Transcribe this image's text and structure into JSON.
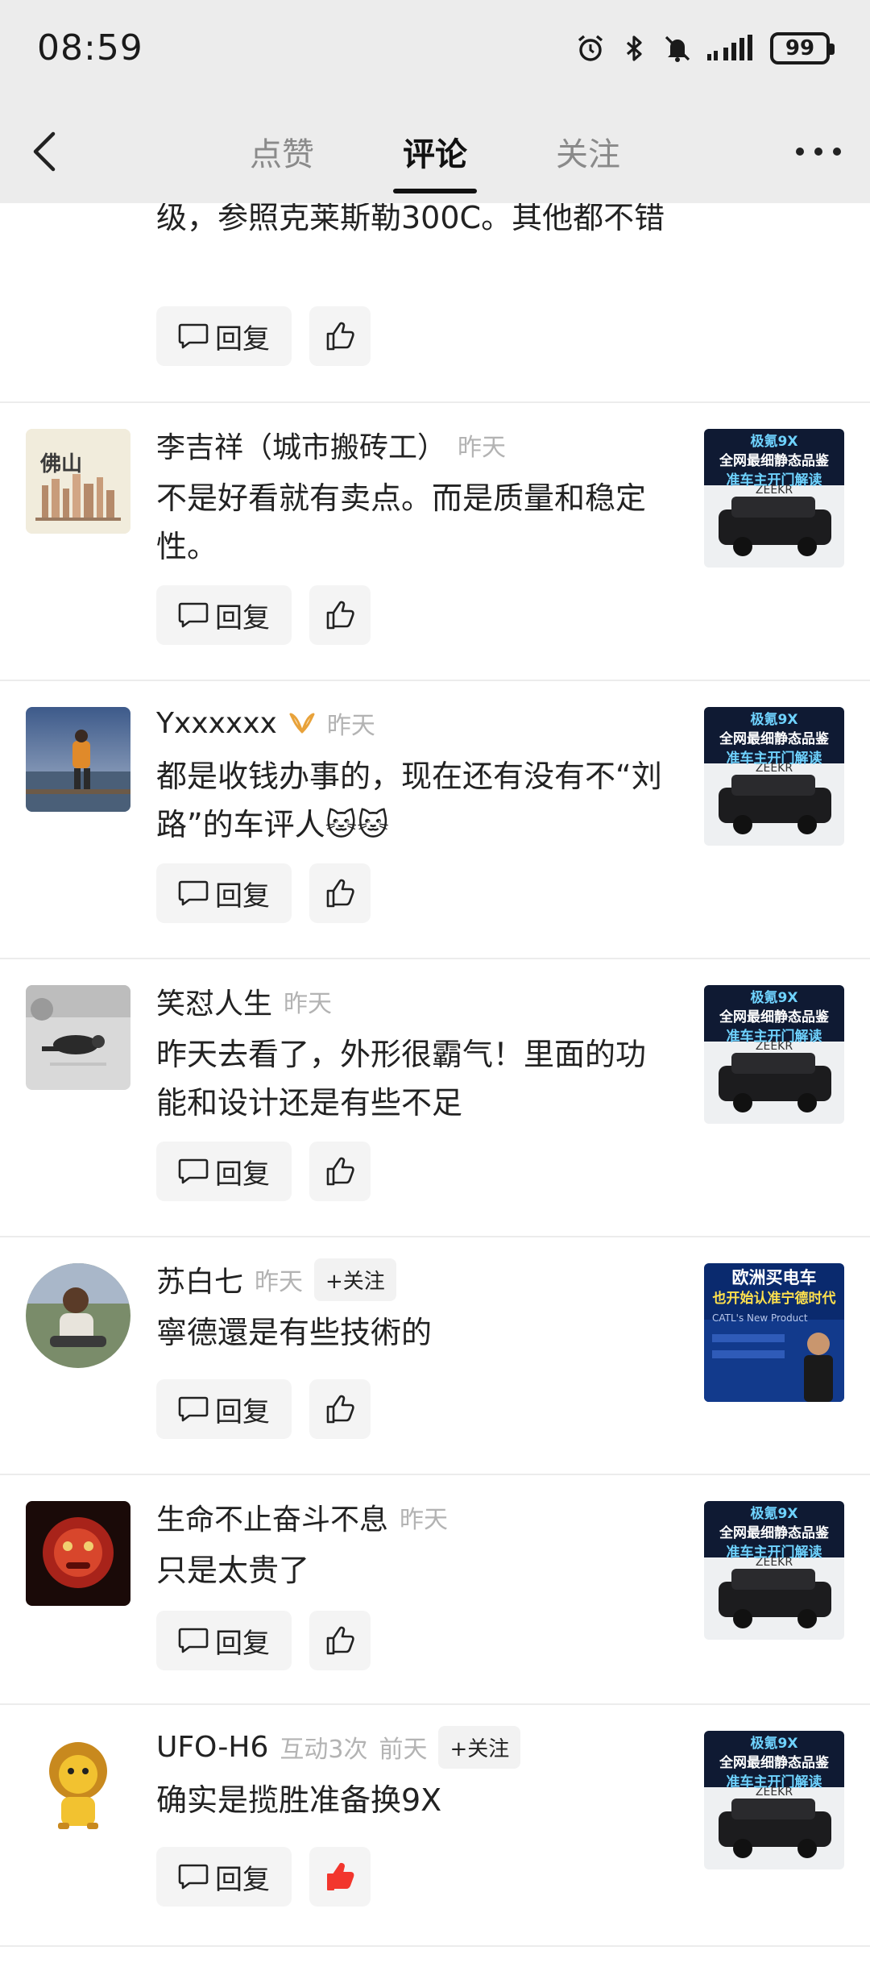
{
  "status": {
    "time": "08:59",
    "battery": "99"
  },
  "nav": {
    "tabs": [
      "点赞",
      "评论",
      "关注"
    ],
    "active_tab": "评论"
  },
  "buttons": {
    "reply": "回复"
  },
  "thumbs": {
    "car": {
      "line1": "极氪9X",
      "line2": "全网最细静态品鉴",
      "line3": "准车主开门解读",
      "brand": "ZEEKR"
    },
    "news": {
      "line1": "欧洲买电车",
      "line2": "也开始认准宁德时代",
      "sub": "CATL's New Product"
    }
  },
  "comments": [
    {
      "content": "级，参照克莱斯勒300C。其他都不错"
    },
    {
      "username": "李吉祥（城市搬砖工）",
      "time": "昨天",
      "content": "不是好看就有卖点。而是质量和稳定性。",
      "avatar_text": "佛山"
    },
    {
      "username": "Yxxxxxx",
      "time": "昨天",
      "content": "都是收钱办事的，现在还有没有不“刘路”的车评人🐱🐱"
    },
    {
      "username": "笑怼人生",
      "time": "昨天",
      "content": "昨天去看了，外形很霸气！里面的功能和设计还是有些不足"
    },
    {
      "username": "苏白七",
      "time": "昨天",
      "follow": "+关注",
      "content": "寧德還是有些技術的"
    },
    {
      "username": "生命不止奋斗不息",
      "time": "昨天",
      "content": "只是太贵了"
    },
    {
      "username": "UFO-H6",
      "interact": "互动3次",
      "time": "前天",
      "follow": "+关注",
      "content": "确实是揽胜准备换9X"
    }
  ],
  "colors": {
    "accent_like": "#f2362d",
    "vip_gold": "#e8a23a"
  }
}
